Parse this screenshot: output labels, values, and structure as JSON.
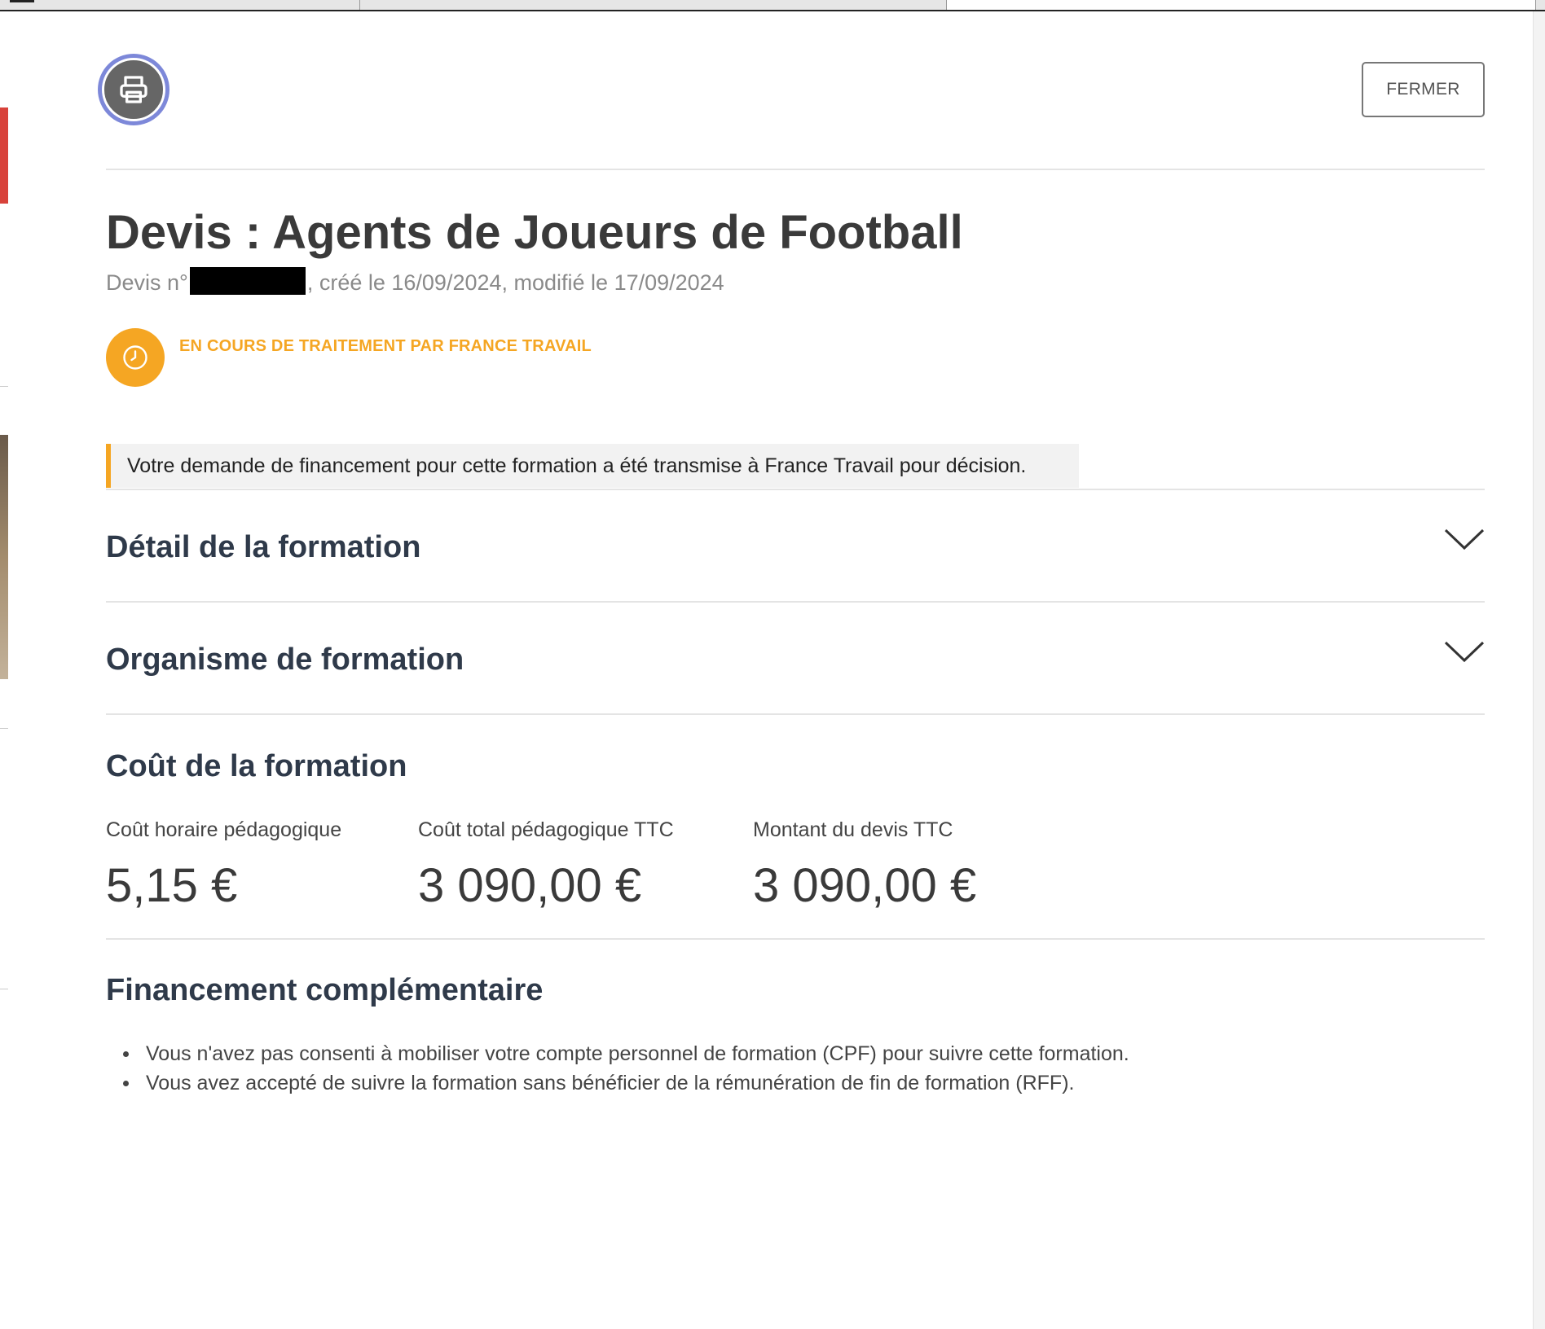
{
  "header": {
    "print_icon": "printer-icon",
    "close_label": "FERMER"
  },
  "quote": {
    "title": "Devis : Agents de Joueurs de Football",
    "number_prefix": "Devis n°",
    "dates": ", créé le 16/09/2024, modifié le 17/09/2024"
  },
  "status": {
    "icon": "clock-icon",
    "label": "EN COURS DE TRAITEMENT PAR FRANCE TRAVAIL",
    "color": "#f5a623"
  },
  "notice": "Votre demande de financement pour cette formation a été transmise à France Travail pour décision.",
  "sections": {
    "detail": "Détail de la formation",
    "organisme": "Organisme de formation"
  },
  "cost": {
    "title": "Coût de la formation",
    "items": [
      {
        "label": "Coût horaire pédagogique",
        "value": "5,15 €"
      },
      {
        "label": "Coût total pédagogique TTC",
        "value": "3 090,00 €"
      },
      {
        "label": "Montant du devis TTC",
        "value": "3 090,00 €"
      }
    ]
  },
  "financing": {
    "title": "Financement complémentaire",
    "items": [
      "Vous n'avez pas consenti à mobiliser votre compte personnel de formation (CPF) pour suivre cette formation.",
      "Vous avez accepté de suivre la formation sans bénéficier de la rémunération de fin de formation (RFF)."
    ]
  },
  "colors": {
    "accent": "#f5a623",
    "heading": "#2f3a4a",
    "print_ring": "#7d88d9"
  }
}
